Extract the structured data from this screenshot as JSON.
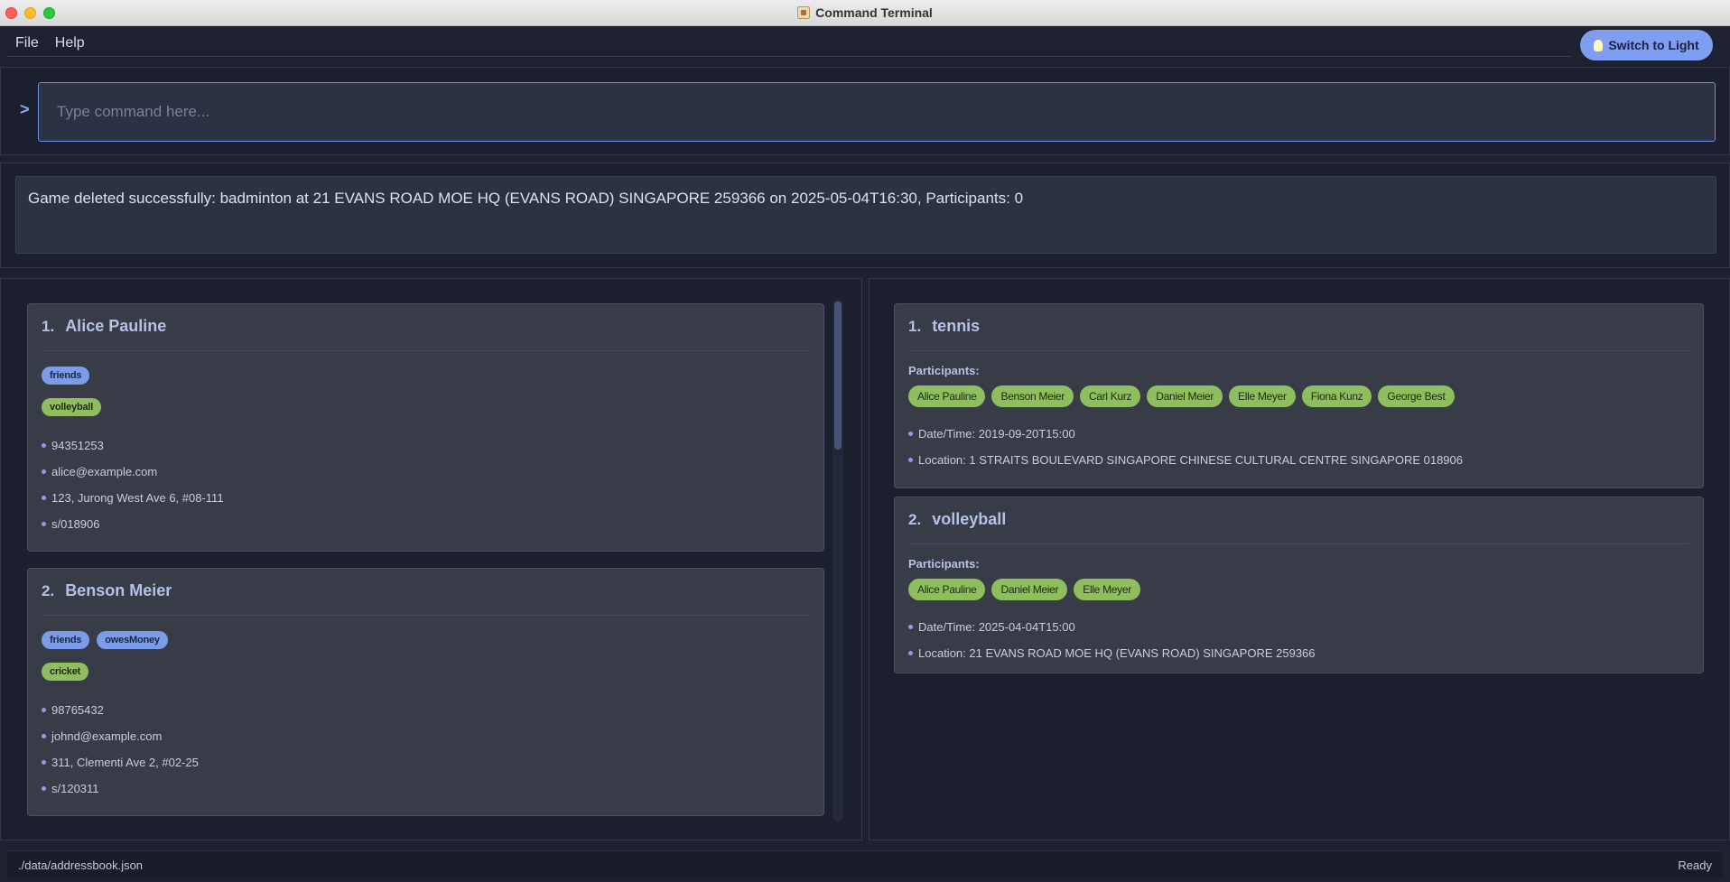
{
  "window": {
    "title": "Command Terminal"
  },
  "menu": {
    "file": "File",
    "help": "Help"
  },
  "theme_button": {
    "label": "Switch to Light",
    "icon": "lightbulb-icon"
  },
  "command": {
    "prompt": ">",
    "placeholder": "Type command here...",
    "value": ""
  },
  "result": {
    "message": "Game deleted successfully: badminton at 21 EVANS ROAD MOE HQ (EVANS ROAD) SINGAPORE 259366 on 2025-05-04T16:30, Participants: 0"
  },
  "persons": [
    {
      "index": "1.",
      "name": "Alice Pauline",
      "tags": [
        "friends"
      ],
      "sports": [
        "volleyball"
      ],
      "phone": "94351253",
      "email": "alice@example.com",
      "address": "123, Jurong West Ave 6, #08-111",
      "postal": "s/018906"
    },
    {
      "index": "2.",
      "name": "Benson Meier",
      "tags": [
        "friends",
        "owesMoney"
      ],
      "sports": [
        "cricket"
      ],
      "phone": "98765432",
      "email": "johnd@example.com",
      "address": "311, Clementi Ave 2, #02-25",
      "postal": "s/120311"
    }
  ],
  "games": [
    {
      "index": "1.",
      "sport": "tennis",
      "participants_label": "Participants:",
      "participants": [
        "Alice Pauline",
        "Benson Meier",
        "Carl Kurz",
        "Daniel Meier",
        "Elle Meyer",
        "Fiona Kunz",
        "George Best"
      ],
      "datetime": "Date/Time: 2019-09-20T15:00",
      "location": "Location: 1 STRAITS BOULEVARD SINGAPORE CHINESE CULTURAL CENTRE SINGAPORE 018906"
    },
    {
      "index": "2.",
      "sport": "volleyball",
      "participants_label": "Participants:",
      "participants": [
        "Alice Pauline",
        "Daniel Meier",
        "Elle Meyer"
      ],
      "datetime": "Date/Time: 2025-04-04T15:00",
      "location": "Location: 21 EVANS ROAD MOE HQ (EVANS ROAD) SINGAPORE 259366"
    }
  ],
  "status": {
    "path": "./data/addressbook.json",
    "state": "Ready"
  },
  "colors": {
    "accent": "#7f9ef2",
    "tag_blue": "#7b9ce8",
    "tag_green": "#8fbe5f",
    "background": "#1e2130"
  }
}
